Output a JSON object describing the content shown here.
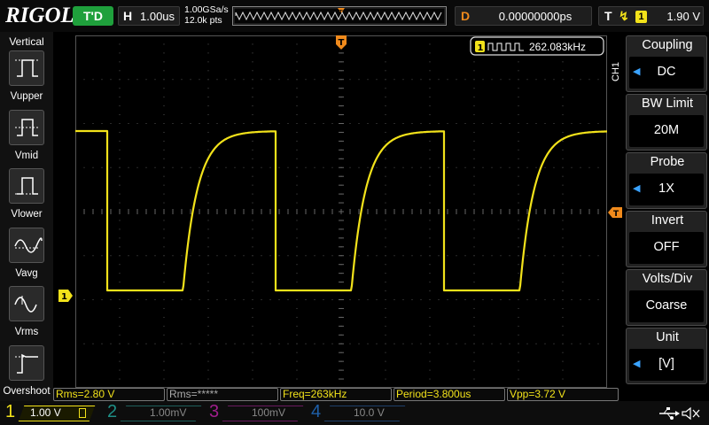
{
  "topbar": {
    "logo": "RIGOL",
    "run_state": "T'D",
    "horizontal_label": "H",
    "timebase": "1.00us",
    "sample_rate": "1.00GSa/s",
    "memory_depth": "12.0k pts",
    "delay_label": "D",
    "delay": "0.00000000ps",
    "trigger_label": "T",
    "trigger_edge_icon": "rising-edge-icon",
    "trigger_source": "1",
    "trigger_level": "1.90 V"
  },
  "measure_menu": {
    "heading": "Vertical",
    "items": [
      {
        "label": "Vupper",
        "icon": "vupper-icon"
      },
      {
        "label": "Vmid",
        "icon": "vmid-icon"
      },
      {
        "label": "Vlower",
        "icon": "vlower-icon"
      },
      {
        "label": "Vavg",
        "icon": "vavg-icon"
      },
      {
        "label": "Vrms",
        "icon": "vrms-icon"
      },
      {
        "label": "Overshoot",
        "icon": "overshoot-icon"
      }
    ]
  },
  "frequency_counter": {
    "channel": "1",
    "value": "262.083kHz"
  },
  "channel_tag": "CH1",
  "channel_menu": {
    "items": [
      {
        "title": "Coupling",
        "value": "DC"
      },
      {
        "title": "BW Limit",
        "value": "20M"
      },
      {
        "title": "Probe",
        "value": "1X"
      },
      {
        "title": "Invert",
        "value": "OFF"
      },
      {
        "title": "Volts/Div",
        "value": "Coarse"
      },
      {
        "title": "Unit",
        "value": "[V]"
      }
    ]
  },
  "measurements": [
    "Rms=2.80 V",
    "Rms=*****",
    "Freq=263kHz",
    "Period=3.800us",
    "Vpp=3.72 V"
  ],
  "channels": [
    {
      "num": "1",
      "scale": "1.00 V",
      "color": "#f2e21a"
    },
    {
      "num": "2",
      "scale": "1.00mV",
      "color": "#1e8f86"
    },
    {
      "num": "3",
      "scale": "100mV",
      "color": "#a01e8c"
    },
    {
      "num": "4",
      "scale": "10.0 V",
      "color": "#1e5fa8"
    }
  ],
  "colors": {
    "trace": "#f2e21a",
    "trigger": "#f08a1c",
    "accent": "#3aa3ff",
    "run_state": "#1fa03c"
  },
  "waveform": {
    "shape": "square-wave-with-exponential-rise",
    "period_us": 3.8,
    "high_v": 3.72,
    "low_v": 0.0,
    "timebase_us_per_div": 1.0,
    "volts_per_div": 1.0
  }
}
